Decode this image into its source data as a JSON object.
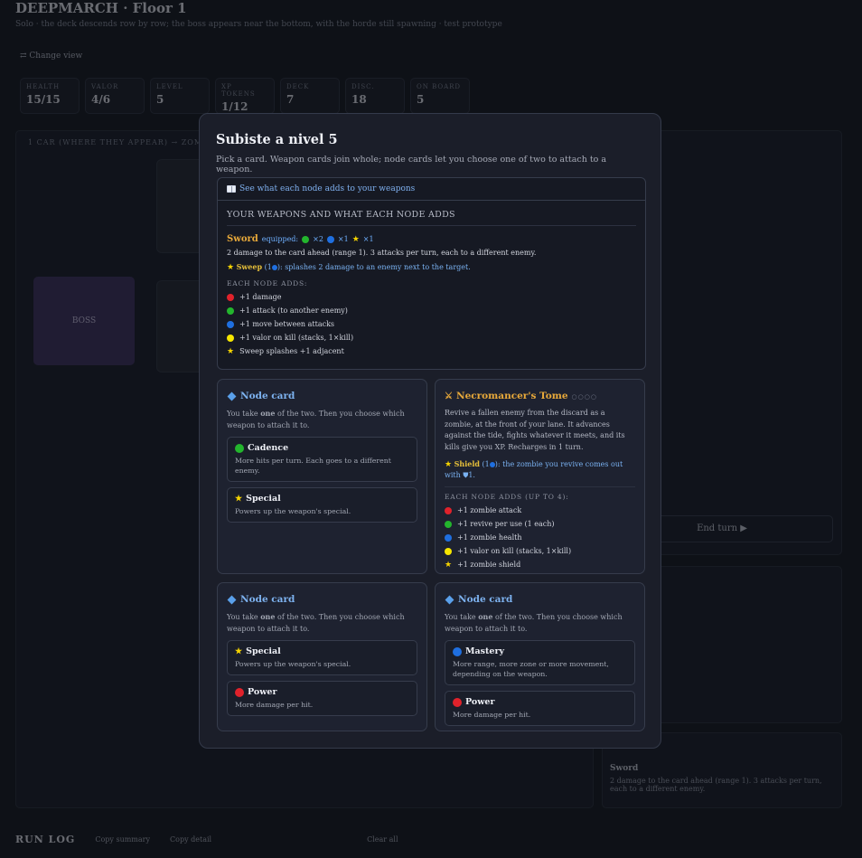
{
  "background": {
    "title": "DEEPMARCH · Floor 1",
    "subtitle": "Solo · the deck descends row by row; the boss appears near the bottom, with the horde still spawning · test prototype",
    "change_view": "⇄ Change view",
    "stats": [
      {
        "label": "HEALTH",
        "value": "15/15"
      },
      {
        "label": "VALOR",
        "value": "4/6"
      },
      {
        "label": "LEVEL",
        "value": "5"
      },
      {
        "label": "XP TOKENS",
        "value": "1/12"
      },
      {
        "label": "DECK",
        "value": "7"
      },
      {
        "label": "DISC.",
        "value": "18"
      },
      {
        "label": "ON BOARD",
        "value": "5"
      }
    ],
    "lane_label": "1 CAR (WHERE THEY APPEAR) → ZOMBIE",
    "boss_label": "BOSS",
    "end_turn": "End turn ▶",
    "run_log": "RUN LOG",
    "copy_summary": "Copy summary",
    "copy_detail": "Copy detail",
    "clear_all": "Clear all",
    "equipped_weapon": "Sword",
    "equipped_desc": "2 damage to the card ahead (range 1). 3 attacks per turn, each to a different enemy."
  },
  "modal": {
    "title": "Subiste a nivel 5",
    "intro": "Pick a card. Weapon cards join whole; node cards let you choose one of two to attach to a weapon.",
    "reference": {
      "toggle_label": "See what each node adds to your weapons",
      "heading": "YOUR WEAPONS AND WHAT EACH NODE ADDS",
      "weapon_name": "Sword",
      "equipped_label": "equipped:",
      "equipped_counts": [
        "×2",
        "×1",
        "×1"
      ],
      "description": "2 damage to the card ahead (range 1). 3 attacks per turn, each to a different enemy.",
      "special_name": "Sweep",
      "special_level": "(1",
      "special_text": "): splashes 2 damage to an enemy next to the target.",
      "each_node_label": "EACH NODE ADDS:",
      "adds": [
        {
          "color": "red",
          "text": "+1 damage"
        },
        {
          "color": "green",
          "text": "+1 attack (to another enemy)"
        },
        {
          "color": "blue",
          "text": "+1 move between attacks"
        },
        {
          "color": "yellow",
          "text": "+1 valor on kill (stacks, 1×kill)"
        },
        {
          "color": "star",
          "text": "Sweep splashes +1 adjacent"
        }
      ]
    },
    "cards": [
      {
        "title": "Node card",
        "desc_pre": "You take ",
        "desc_bold": "one",
        "desc_post": " of the two. Then you choose which weapon to attach it to.",
        "options": [
          {
            "color": "green",
            "name": "Cadence",
            "desc": "More hits per turn. Each goes to a different enemy."
          },
          {
            "color": "star",
            "name": "Special",
            "desc": "Powers up the weapon's special."
          }
        ]
      },
      {
        "title": "Node card",
        "desc_pre": "You take ",
        "desc_bold": "one",
        "desc_post": " of the two. Then you choose which weapon to attach it to.",
        "options": [
          {
            "color": "star",
            "name": "Special",
            "desc": "Powers up the weapon's special."
          },
          {
            "color": "red",
            "name": "Power",
            "desc": "More damage per hit."
          }
        ]
      },
      {
        "title": "Node card",
        "desc_pre": "You take ",
        "desc_bold": "one",
        "desc_post": " of the two. Then you choose which weapon to attach it to.",
        "options": [
          {
            "color": "blue",
            "name": "Mastery",
            "desc": "More range, more zone or more movement, depending on the weapon."
          },
          {
            "color": "red",
            "name": "Power",
            "desc": "More damage per hit."
          }
        ]
      }
    ],
    "tome": {
      "title": "Necromancer's Tome",
      "pips": "○○○○",
      "desc": "Revive a fallen enemy from the discard as a zombie, at the front of your lane. It advances against the tide, fights whatever it meets, and its kills give you XP. Recharges in 1 turn.",
      "special_name": "Shield",
      "special_level": "(1",
      "special_text": "): the zombie you revive comes out with ",
      "special_tail": "1.",
      "each_node_label": "EACH NODE ADDS (UP TO 4):",
      "adds": [
        {
          "color": "red",
          "text": "+1 zombie attack"
        },
        {
          "color": "green",
          "text": "+1 revive per use (1 each)"
        },
        {
          "color": "blue",
          "text": "+1 zombie health"
        },
        {
          "color": "yellow",
          "text": "+1 valor on kill (stacks, 1×kill)"
        },
        {
          "color": "star",
          "text": "+1 zombie shield"
        }
      ]
    }
  }
}
